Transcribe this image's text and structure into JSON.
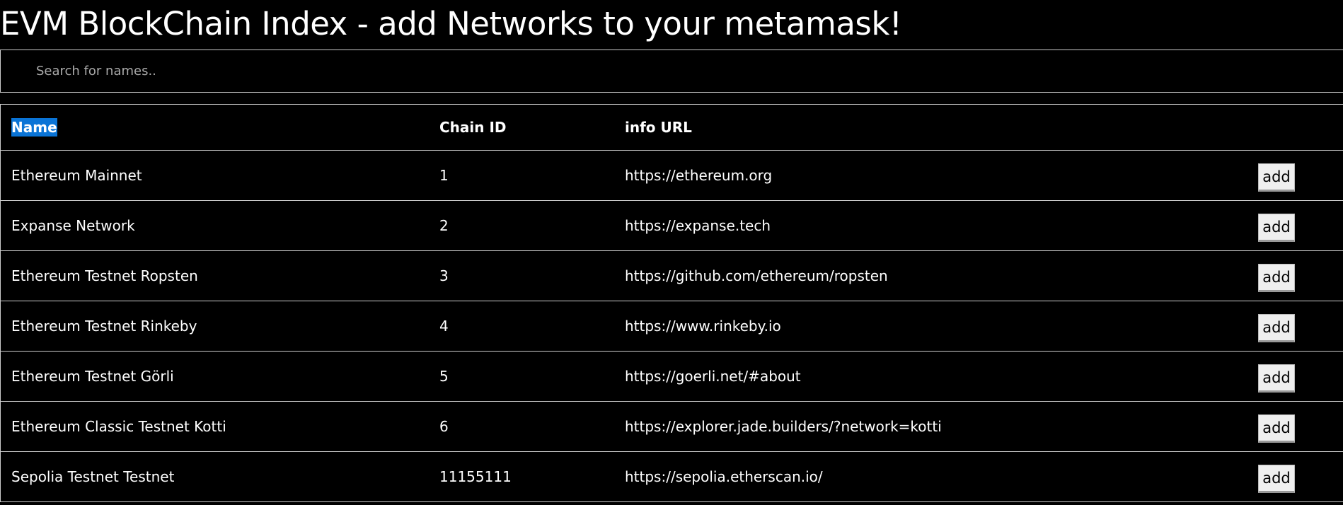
{
  "header": {
    "title": "EVM BlockChain Index - add Networks to your metamask!"
  },
  "search": {
    "placeholder": "Search for names..",
    "value": ""
  },
  "table": {
    "columns": [
      "Name",
      "Chain ID",
      "info URL"
    ],
    "sorted_column": "Name",
    "highlight_color": "#0a74d6",
    "add_label": "add",
    "rows": [
      {
        "name": "Ethereum Mainnet",
        "chain_id": "1",
        "url": "https://ethereum.org"
      },
      {
        "name": "Expanse Network",
        "chain_id": "2",
        "url": "https://expanse.tech"
      },
      {
        "name": "Ethereum Testnet Ropsten",
        "chain_id": "3",
        "url": "https://github.com/ethereum/ropsten"
      },
      {
        "name": "Ethereum Testnet Rinkeby",
        "chain_id": "4",
        "url": "https://www.rinkeby.io"
      },
      {
        "name": "Ethereum Testnet Görli",
        "chain_id": "5",
        "url": "https://goerli.net/#about"
      },
      {
        "name": "Ethereum Classic Testnet Kotti",
        "chain_id": "6",
        "url": "https://explorer.jade.builders/?network=kotti"
      },
      {
        "name": "Sepolia Testnet Testnet",
        "chain_id": "11155111",
        "url": "https://sepolia.etherscan.io/"
      }
    ]
  }
}
